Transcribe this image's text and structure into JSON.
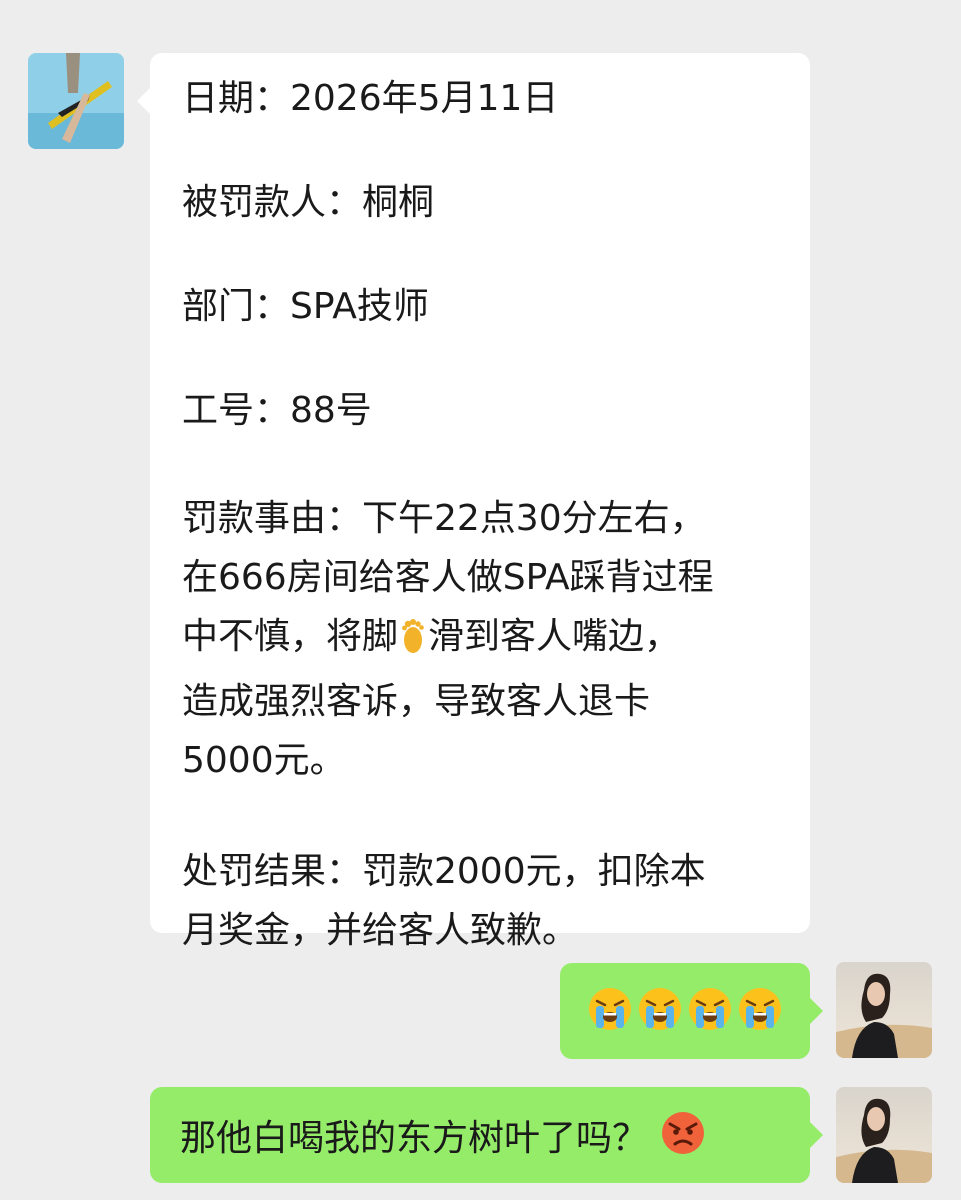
{
  "chat": {
    "incoming": {
      "date": "日期：2026年5月11日",
      "penalized": "被罚款人：桐桐",
      "department": "部门：SPA技师",
      "employee_no": "工号：88号",
      "reason_lines": [
        "罚款事由：下午22点30分左右，",
        "在666房间给客人做SPA踩背过程",
        "中不慎，将脚",
        "滑到客人嘴边，",
        "造成强烈客诉，导致客人退卡",
        "5000元。"
      ],
      "result_lines": [
        "处罚结果：罚款2000元，扣除本",
        "月奖金，并给客人致歉。"
      ]
    },
    "outgoing_emoji": {
      "icons": [
        "loudly-crying-face",
        "loudly-crying-face",
        "loudly-crying-face",
        "loudly-crying-face"
      ]
    },
    "outgoing_reply": {
      "text": "那他白喝我的东方树叶了吗？",
      "icon": "angry-face"
    }
  },
  "colors": {
    "background": "#ededed",
    "incoming_bubble": "#ffffff",
    "outgoing_bubble": "#95ec69"
  }
}
